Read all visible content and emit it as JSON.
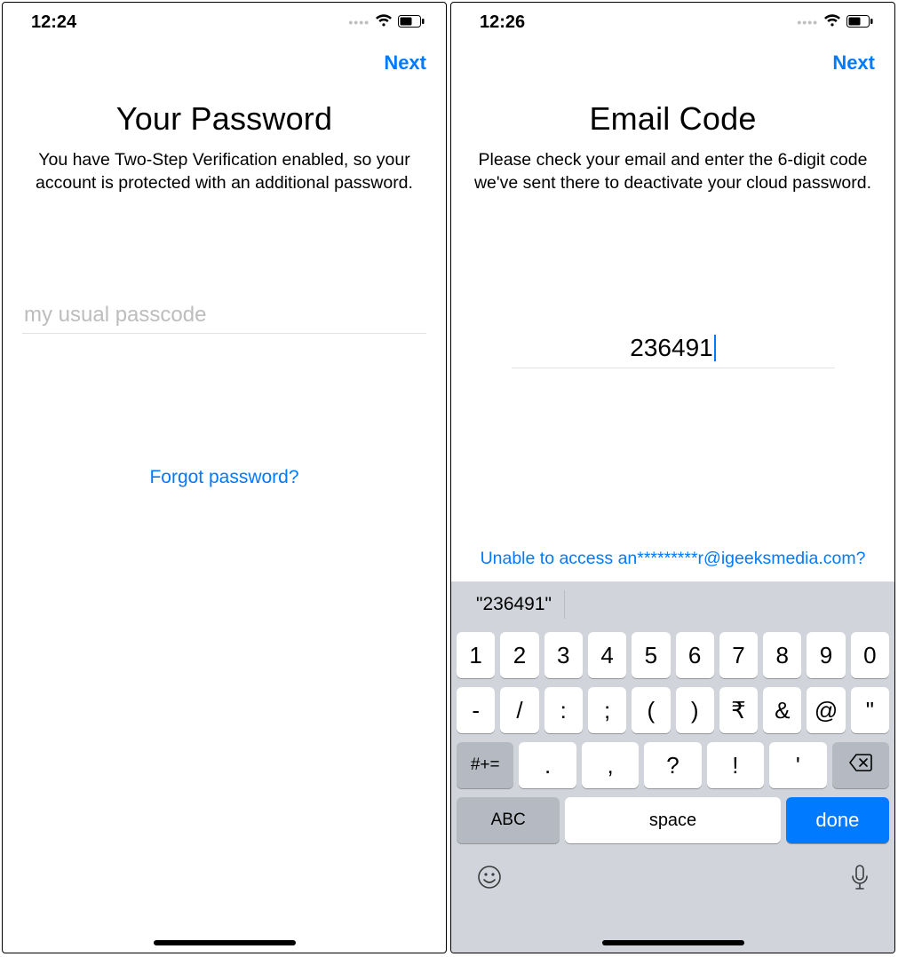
{
  "left": {
    "status": {
      "time": "12:24"
    },
    "nav": {
      "next": "Next"
    },
    "title": "Your Password",
    "description": "You have Two-Step Verification enabled, so your account is protected with an additional password.",
    "input": {
      "placeholder": "my usual passcode",
      "value": ""
    },
    "forgot": "Forgot password?"
  },
  "right": {
    "status": {
      "time": "12:26"
    },
    "nav": {
      "next": "Next"
    },
    "title": "Email Code",
    "description": "Please check your email and enter the 6-digit code we've sent there to deactivate your cloud password.",
    "code": "236491",
    "unable": "Unable to access an*********r@igeeksmedia.com?",
    "keyboard": {
      "suggestion": "\"236491\"",
      "row1": [
        "1",
        "2",
        "3",
        "4",
        "5",
        "6",
        "7",
        "8",
        "9",
        "0"
      ],
      "row2": [
        "-",
        "/",
        ":",
        ";",
        "(",
        ")",
        "₹",
        "&",
        "@",
        "\""
      ],
      "row3": {
        "shift": "#+=",
        "keys": [
          ".",
          ",",
          "?",
          "!",
          "'"
        ]
      },
      "row4": {
        "abc": "ABC",
        "space": "space",
        "done": "done"
      }
    }
  }
}
